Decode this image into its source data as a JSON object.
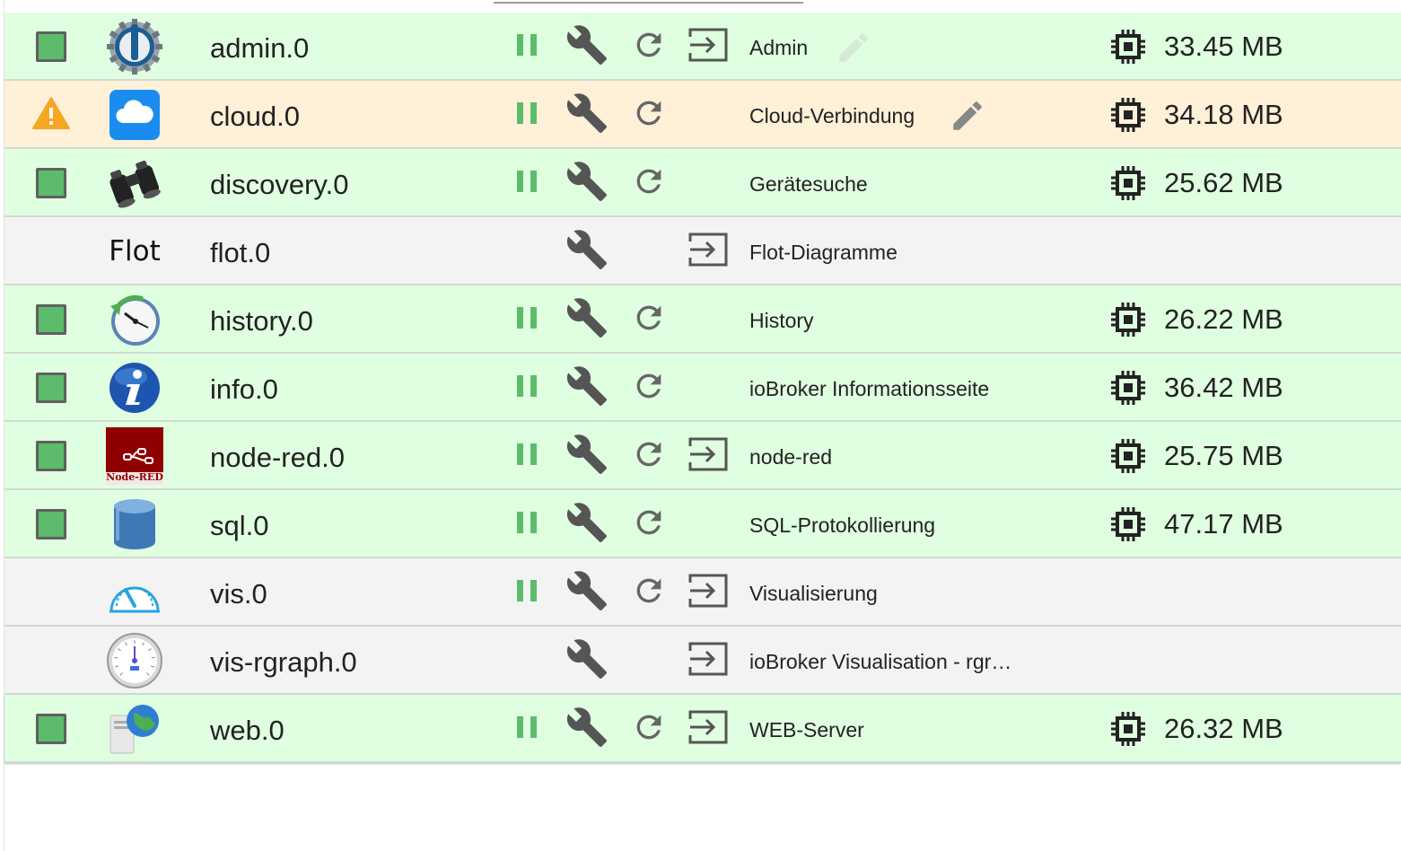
{
  "colors": {
    "running_row": "#e0ffe0",
    "warning_row": "#fff0d8",
    "stopped_row": "#f3f3f3",
    "status_green": "#5cbc6c",
    "pause_green": "#5cbc6c",
    "icon_grey": "#555555"
  },
  "instances": [
    {
      "name": "admin.0",
      "title": "Admin",
      "memory": "33.45 MB",
      "status": "running",
      "icon": "admin-icon",
      "has_pause": true,
      "has_restart": true,
      "has_open": true,
      "has_edit": true
    },
    {
      "name": "cloud.0",
      "title": "Cloud-Verbindung",
      "memory": "34.18 MB",
      "status": "warning",
      "icon": "cloud-icon",
      "has_pause": true,
      "has_restart": true,
      "has_open": false,
      "has_edit": true
    },
    {
      "name": "discovery.0",
      "title": "Gerätesuche",
      "memory": "25.62 MB",
      "status": "running",
      "icon": "binoculars-icon",
      "has_pause": true,
      "has_restart": true,
      "has_open": false,
      "has_edit": false
    },
    {
      "name": "flot.0",
      "title": "Flot-Diagramme",
      "memory": "",
      "status": "none",
      "icon": "flot-logo",
      "logo_text": "Flot",
      "has_pause": false,
      "has_restart": false,
      "has_open": true,
      "has_edit": false
    },
    {
      "name": "history.0",
      "title": "History",
      "memory": "26.22 MB",
      "status": "running",
      "icon": "clock-history-icon",
      "has_pause": true,
      "has_restart": true,
      "has_open": false,
      "has_edit": false
    },
    {
      "name": "info.0",
      "title": "ioBroker Informationsseite",
      "memory": "36.42 MB",
      "status": "running",
      "icon": "info-icon",
      "has_pause": true,
      "has_restart": true,
      "has_open": false,
      "has_edit": false
    },
    {
      "name": "node-red.0",
      "title": "node-red",
      "memory": "25.75 MB",
      "status": "running",
      "icon": "node-red-icon",
      "logo_text": "Node-RED",
      "has_pause": true,
      "has_restart": true,
      "has_open": true,
      "has_edit": false
    },
    {
      "name": "sql.0",
      "title": "SQL-Protokollierung",
      "memory": "47.17 MB",
      "status": "running",
      "icon": "database-icon",
      "has_pause": true,
      "has_restart": true,
      "has_open": false,
      "has_edit": false
    },
    {
      "name": "vis.0",
      "title": "Visualisierung",
      "memory": "",
      "status": "none",
      "icon": "gauge-icon",
      "has_pause": true,
      "has_restart": true,
      "has_open": true,
      "has_edit": false
    },
    {
      "name": "vis-rgraph.0",
      "title": "ioBroker Visualisation - rgr…",
      "memory": "",
      "status": "none",
      "icon": "dial-gauge-icon",
      "has_pause": false,
      "has_restart": false,
      "has_open": true,
      "has_edit": false
    },
    {
      "name": "web.0",
      "title": "WEB-Server",
      "memory": "26.32 MB",
      "status": "running",
      "icon": "web-server-icon",
      "has_pause": true,
      "has_restart": true,
      "has_open": true,
      "has_edit": false
    }
  ]
}
